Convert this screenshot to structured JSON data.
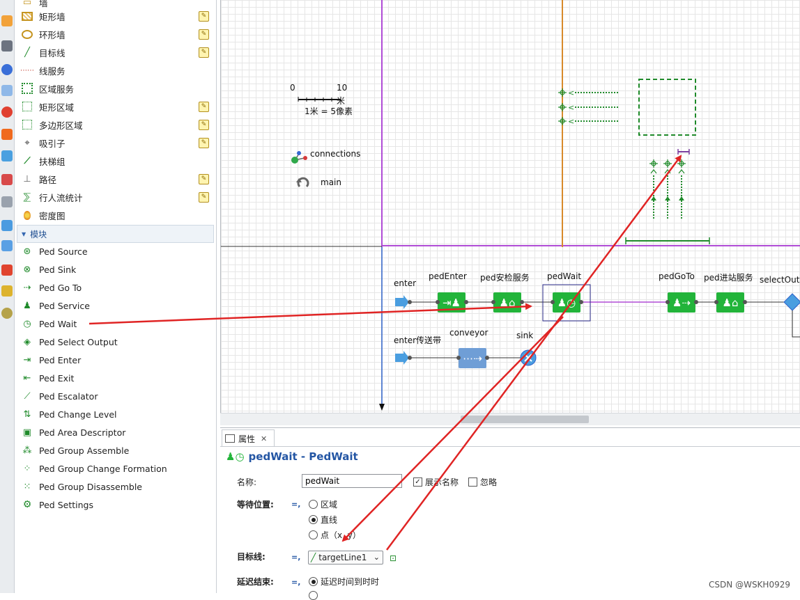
{
  "palette": {
    "items_top": [
      {
        "label": "墙",
        "icon": "wall-icon",
        "editable": false
      },
      {
        "label": "矩形墙",
        "icon": "rectangular-wall-icon",
        "editable": true
      },
      {
        "label": "环形墙",
        "icon": "circular-wall-icon",
        "editable": true
      },
      {
        "label": "目标线",
        "icon": "target-line-icon",
        "editable": true
      },
      {
        "label": "线服务",
        "icon": "line-service-icon",
        "editable": false
      },
      {
        "label": "区域服务",
        "icon": "area-service-icon",
        "editable": false
      },
      {
        "label": "矩形区域",
        "icon": "rectangular-area-icon",
        "editable": true
      },
      {
        "label": "多边形区域",
        "icon": "polygonal-area-icon",
        "editable": true
      },
      {
        "label": "吸引子",
        "icon": "attractor-icon",
        "editable": true
      },
      {
        "label": "扶梯组",
        "icon": "escalator-group-icon",
        "editable": false
      },
      {
        "label": "路径",
        "icon": "path-icon",
        "editable": true
      },
      {
        "label": "行人流统计",
        "icon": "flow-statistics-icon",
        "editable": true
      },
      {
        "label": "密度图",
        "icon": "density-map-icon",
        "editable": false
      }
    ],
    "section_label": "模块",
    "modules": [
      {
        "label": "Ped Source",
        "icon": "ped-source-icon"
      },
      {
        "label": "Ped Sink",
        "icon": "ped-sink-icon"
      },
      {
        "label": "Ped Go To",
        "icon": "ped-go-to-icon"
      },
      {
        "label": "Ped Service",
        "icon": "ped-service-icon"
      },
      {
        "label": "Ped Wait",
        "icon": "ped-wait-icon"
      },
      {
        "label": "Ped Select Output",
        "icon": "ped-select-output-icon"
      },
      {
        "label": "Ped Enter",
        "icon": "ped-enter-icon"
      },
      {
        "label": "Ped Exit",
        "icon": "ped-exit-icon"
      },
      {
        "label": "Ped Escalator",
        "icon": "ped-escalator-icon"
      },
      {
        "label": "Ped Change Level",
        "icon": "ped-change-level-icon"
      },
      {
        "label": "Ped Area Descriptor",
        "icon": "ped-area-descriptor-icon"
      },
      {
        "label": "Ped Group Assemble",
        "icon": "ped-group-assemble-icon"
      },
      {
        "label": "Ped Group Change Formation",
        "icon": "ped-group-change-formation-icon"
      },
      {
        "label": "Ped Group Disassemble",
        "icon": "ped-group-disassemble-icon"
      },
      {
        "label": "Ped Settings",
        "icon": "ped-settings-icon"
      }
    ]
  },
  "canvas": {
    "scale": {
      "start": "0",
      "end": "10",
      "unit": "米",
      "ratio": "1米 = 5像素"
    },
    "connections_label": "connections",
    "main_label": "main",
    "blocks": {
      "enter": "enter",
      "pedEnter": "pedEnter",
      "pedSecurity": "ped安检服务",
      "pedWait": "pedWait",
      "pedGoTo": "pedGoTo",
      "pedStation": "ped进站服务",
      "selectOutput": "selectOutp",
      "enterConveyor": "enter传送带",
      "conveyor": "conveyor",
      "sink": "sink"
    }
  },
  "properties": {
    "tab_label": "属性",
    "title": "pedWait - PedWait",
    "name_label": "名称:",
    "name_value": "pedWait",
    "show_name_label": "展示名称",
    "show_name_checked": true,
    "ignore_label": "忽略",
    "ignore_checked": false,
    "wait_location_label": "等待位置:",
    "wait_options": [
      "区域",
      "直线",
      "点（x, y）"
    ],
    "wait_selected": 1,
    "target_line_label": "目标线:",
    "target_line_value": "targetLine1",
    "delay_end_label": "延迟结束:",
    "delay_option": "延迟时间到时时"
  },
  "watermark": "CSDN @WSKH0929",
  "colors": {
    "block_green": "#22b43a",
    "annotation_red": "#e02424",
    "title_blue": "#2456a4",
    "purple_line": "#b04cd6",
    "blue_line": "#2f62c9",
    "orange_line": "#d88a2a"
  }
}
